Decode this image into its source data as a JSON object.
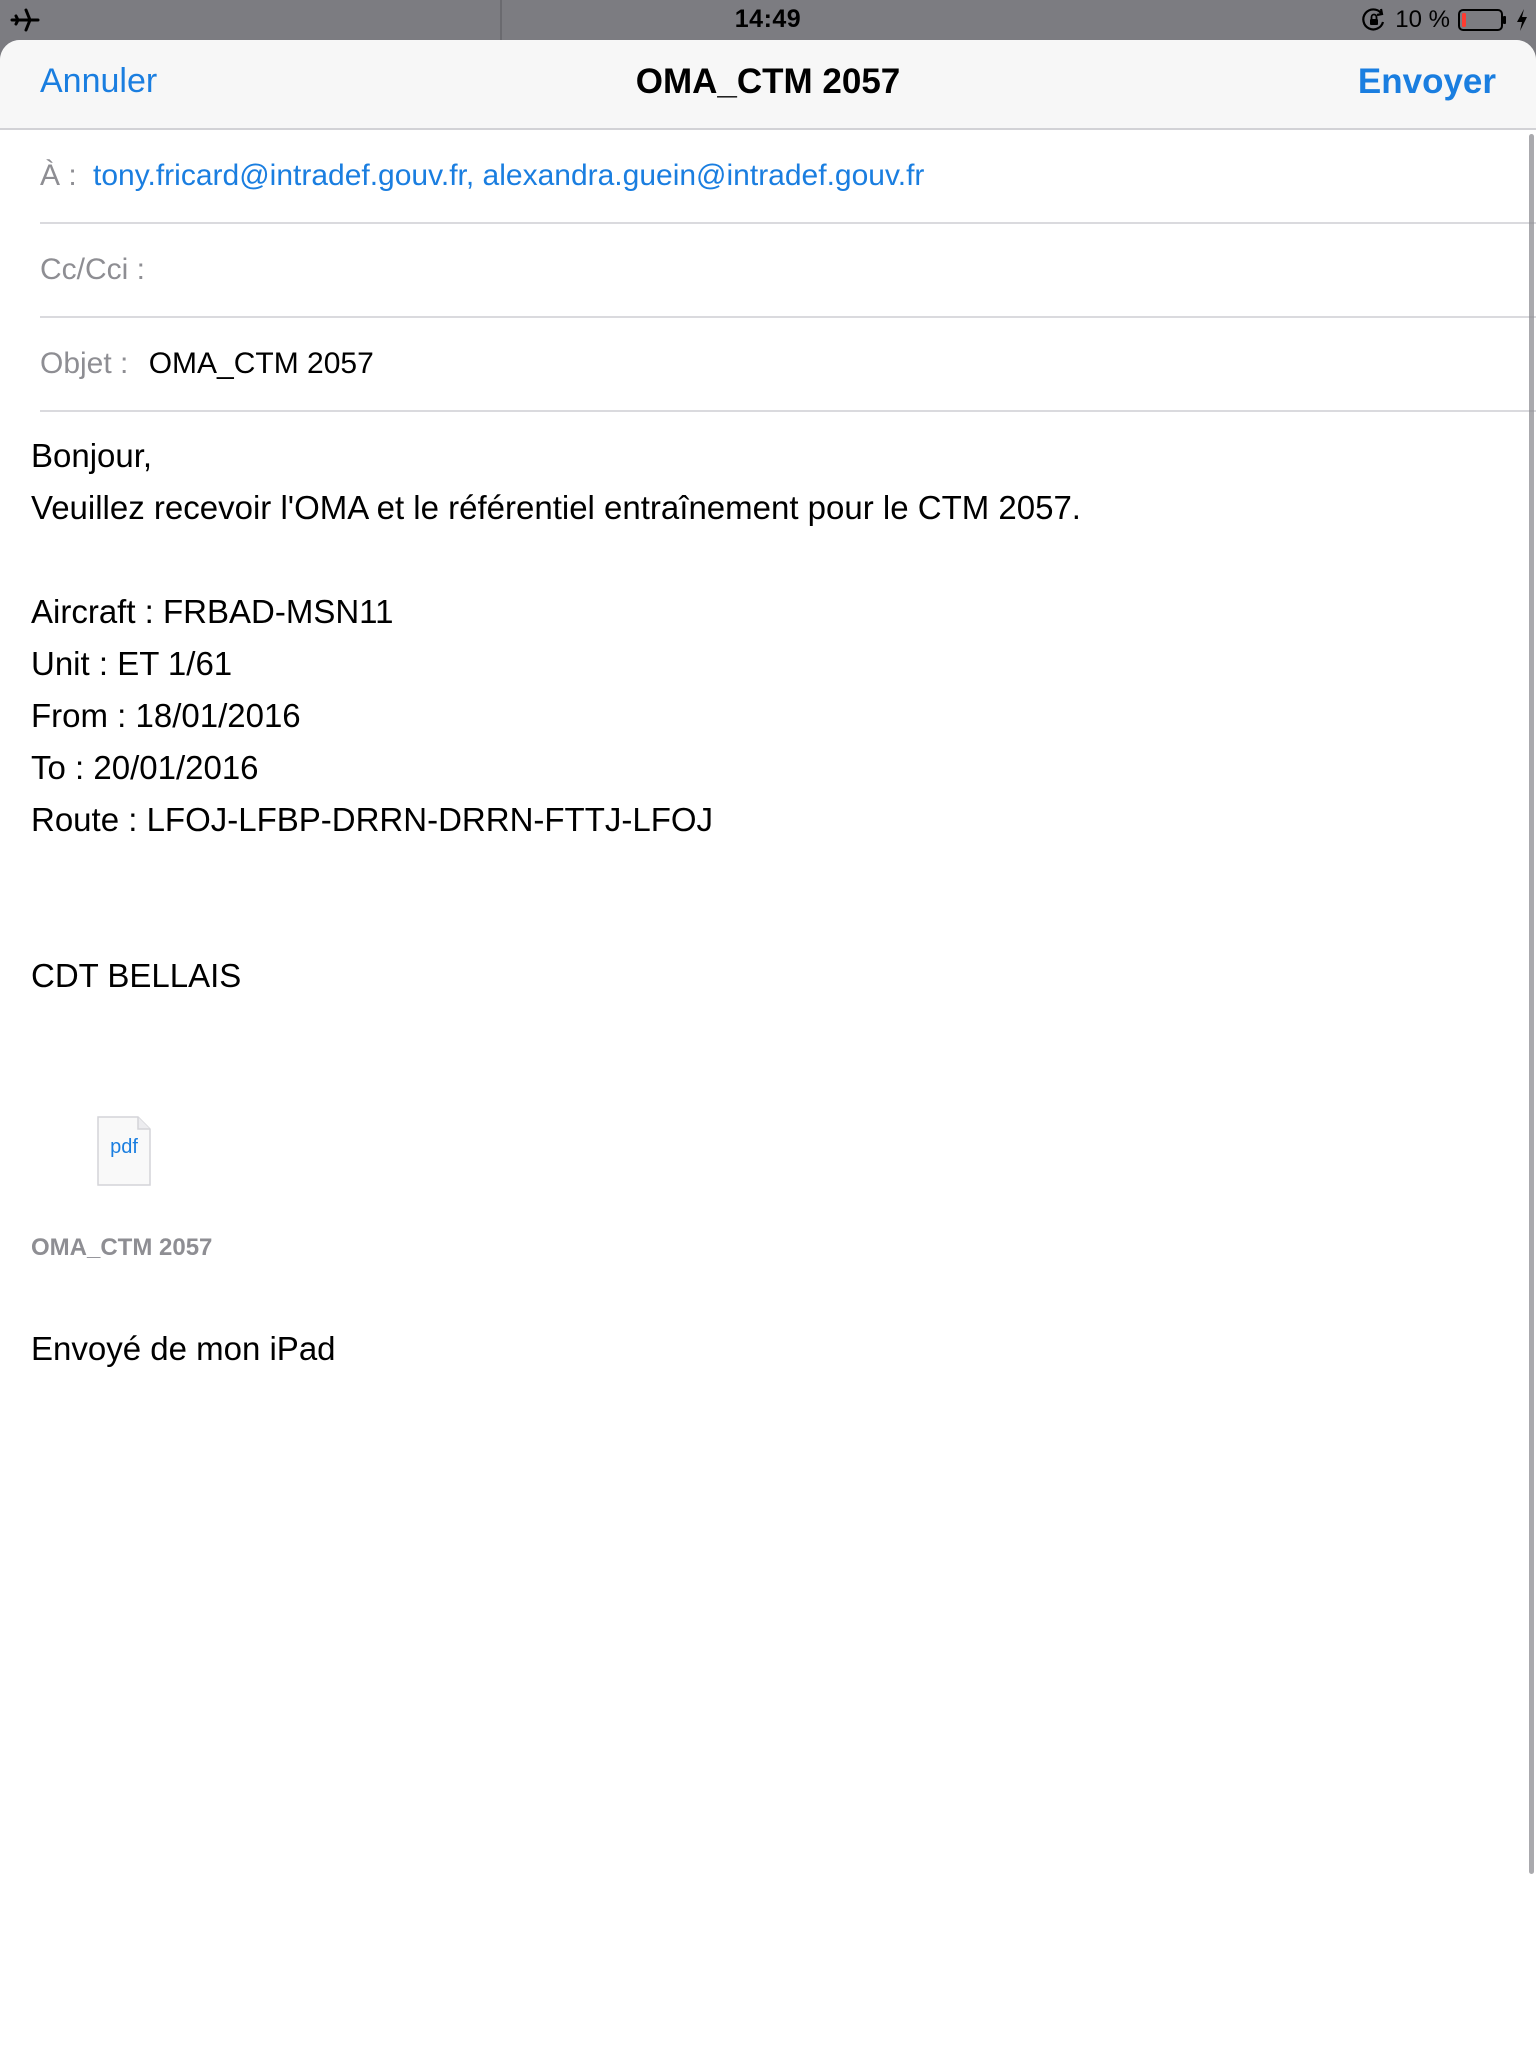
{
  "status_bar": {
    "time": "14:49",
    "battery_percent": "10 %",
    "battery_level": 0.1,
    "battery_color": "#ff3b30",
    "icons": [
      "airplane-icon",
      "rotation-lock-icon",
      "battery-icon",
      "charging-icon"
    ]
  },
  "nav": {
    "cancel_label": "Annuler",
    "title": "OMA_CTM 2057",
    "send_label": "Envoyer"
  },
  "fields": {
    "to_label": "À :",
    "to_value": "tony.fricard@intradef.gouv.fr, alexandra.guein@intradef.gouv.fr",
    "cc_label": "Cc/Cci :",
    "subject_label": "Objet :",
    "subject_value": "OMA_CTM 2057"
  },
  "body": {
    "lines": [
      "Bonjour,",
      "Veuillez recevoir l'OMA et le référentiel entraînement pour le CTM 2057.",
      "",
      "Aircraft : FRBAD-MSN11",
      "Unit : ET 1/61",
      "From : 18/01/2016",
      "To : 20/01/2016",
      "Route : LFOJ-LFBP-DRRN-DRRN-FTTJ-LFOJ",
      "",
      "",
      "CDT BELLAIS"
    ]
  },
  "attachment": {
    "icon_label": "pdf",
    "name": "OMA_CTM 2057"
  },
  "signature": "Envoyé de mon iPad",
  "colors": {
    "accent": "#1a7ee0",
    "label_gray": "#8e8e93"
  }
}
